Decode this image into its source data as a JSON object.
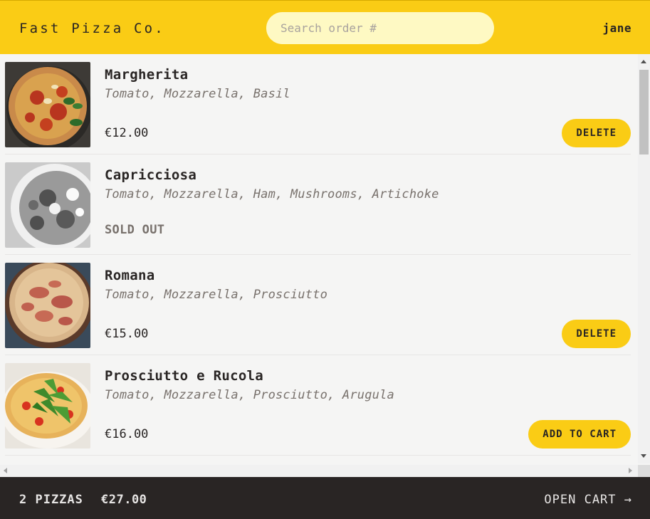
{
  "header": {
    "brand": "Fast Pizza Co.",
    "search_placeholder": "Search order #",
    "username": "jane"
  },
  "menu": {
    "items": [
      {
        "name": "Margherita",
        "ingredients": "Tomato, Mozzarella, Basil",
        "price": "€12.00",
        "sold_out": false,
        "action": "DELETE"
      },
      {
        "name": "Capricciosa",
        "ingredients": "Tomato, Mozzarella, Ham, Mushrooms, Artichoke",
        "status": "SOLD OUT",
        "sold_out": true
      },
      {
        "name": "Romana",
        "ingredients": "Tomato, Mozzarella, Prosciutto",
        "price": "€15.00",
        "sold_out": false,
        "action": "DELETE"
      },
      {
        "name": "Prosciutto e Rucola",
        "ingredients": "Tomato, Mozzarella, Prosciutto, Arugula",
        "price": "€16.00",
        "sold_out": false,
        "action": "ADD TO CART"
      }
    ]
  },
  "footer": {
    "pizza_count": "2 PIZZAS",
    "total": "€27.00",
    "open_cart": "OPEN CART →"
  },
  "colors": {
    "accent": "#facc15",
    "dark": "#292524",
    "muted": "#78716c"
  }
}
